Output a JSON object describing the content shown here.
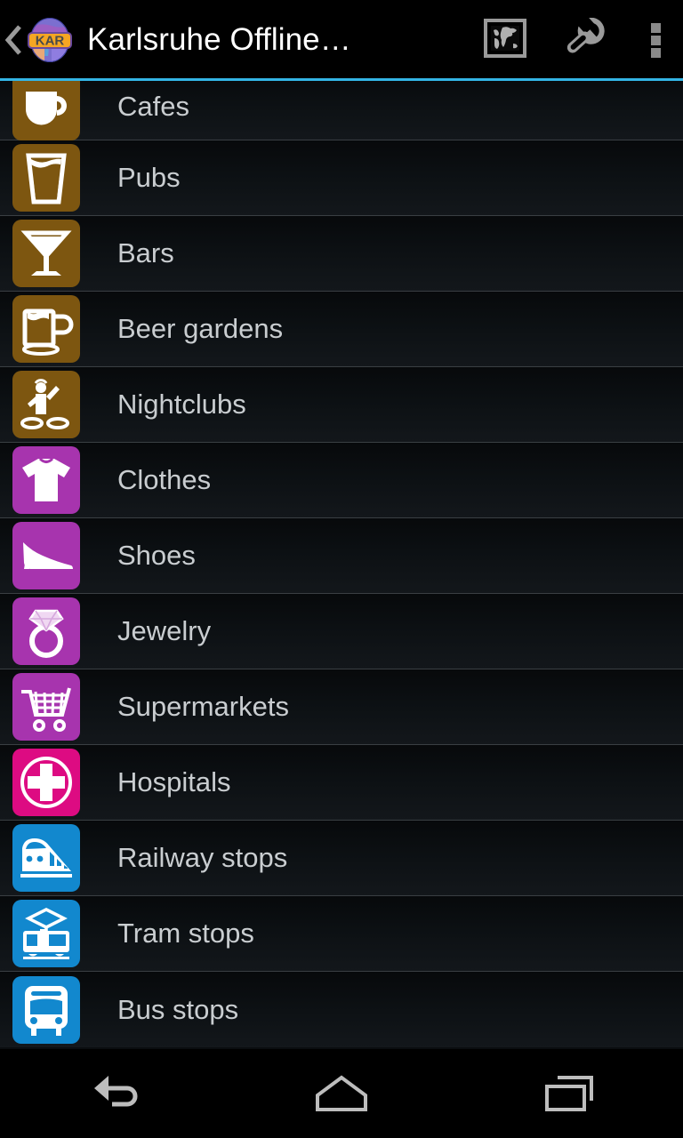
{
  "app": {
    "title": "Karlsruhe Offline…",
    "logo_text": "KAR",
    "accent_color": "#33b5e5"
  },
  "action_bar": {
    "up_label": "Up",
    "up_icon": "chevron-left-icon",
    "logo_icon": "app-globe-logo-icon",
    "actions": [
      {
        "name": "map-action",
        "icon": "world-map-icon",
        "label": "Map"
      },
      {
        "name": "tools-action",
        "icon": "wrench-icon",
        "label": "Tools"
      }
    ],
    "overflow": {
      "icon": "overflow-menu-icon",
      "label": "More options"
    }
  },
  "list": {
    "scrolled": true,
    "items": [
      {
        "label": "Cafes",
        "icon": "coffee-cup-icon",
        "color": "#7d5610",
        "clipped": true
      },
      {
        "label": "Pubs",
        "icon": "beer-glass-icon",
        "color": "#7d5610",
        "clipped": false
      },
      {
        "label": "Bars",
        "icon": "cocktail-glass-icon",
        "color": "#7d5610",
        "clipped": false
      },
      {
        "label": "Beer gardens",
        "icon": "beer-mug-icon",
        "color": "#7d5610",
        "clipped": false
      },
      {
        "label": "Nightclubs",
        "icon": "dj-turntable-icon",
        "color": "#7d5610",
        "clipped": false
      },
      {
        "label": "Clothes",
        "icon": "tshirt-icon",
        "color": "#a734ae",
        "clipped": false
      },
      {
        "label": "Shoes",
        "icon": "high-heel-shoe-icon",
        "color": "#a734ae",
        "clipped": false
      },
      {
        "label": "Jewelry",
        "icon": "diamond-ring-icon",
        "color": "#a734ae",
        "clipped": false
      },
      {
        "label": "Supermarkets",
        "icon": "shopping-cart-icon",
        "color": "#a734ae",
        "clipped": false
      },
      {
        "label": "Hospitals",
        "icon": "medical-cross-icon",
        "color": "#dd0b82",
        "clipped": false
      },
      {
        "label": "Railway stops",
        "icon": "train-icon",
        "color": "#1288ce",
        "clipped": false
      },
      {
        "label": "Tram stops",
        "icon": "tram-icon",
        "color": "#1288ce",
        "clipped": false
      },
      {
        "label": "Bus stops",
        "icon": "bus-icon",
        "color": "#1288ce",
        "clipped": false
      }
    ]
  },
  "nav_bar": {
    "buttons": [
      {
        "name": "nav-back-button",
        "icon": "back-arrow-icon",
        "label": "Back"
      },
      {
        "name": "nav-home-button",
        "icon": "home-icon",
        "label": "Home"
      },
      {
        "name": "nav-recents-button",
        "icon": "recents-icon",
        "label": "Recent apps"
      }
    ]
  }
}
